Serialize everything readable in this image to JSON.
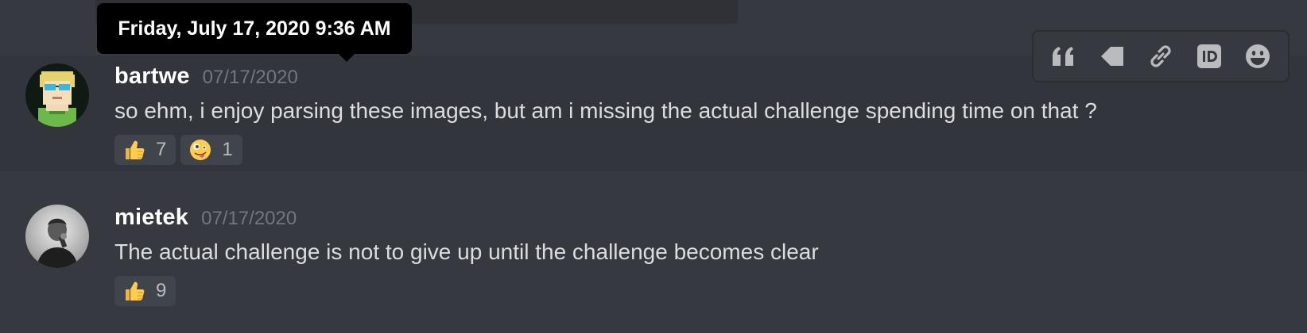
{
  "tooltip": {
    "text": "Friday, July 17, 2020 9:36 AM"
  },
  "messages": [
    {
      "username": "bartwe",
      "timestamp": "07/17/2020",
      "content": "so ehm, i enjoy parsing these images, but am i missing the actual challenge spending time on that ?",
      "avatar": "pixel-art-avatar",
      "reactions": [
        {
          "emoji": "thumbs-up-icon",
          "count": "7"
        },
        {
          "emoji": "zany-face-icon",
          "count": "1"
        }
      ]
    },
    {
      "username": "mietek",
      "timestamp": "07/17/2020",
      "content": "The actual challenge is not to give up until the challenge becomes clear",
      "avatar": "photo-avatar",
      "reactions": [
        {
          "emoji": "thumbs-up-icon",
          "count": "9"
        }
      ]
    }
  ],
  "toolbar": {
    "buttons": [
      "quote-icon",
      "tag-icon",
      "link-icon",
      "id-icon",
      "emoji-icon"
    ]
  },
  "colors": {
    "background": "#36393f",
    "hover_background": "#32353b",
    "username": "#ffffff",
    "timestamp": "#72767d",
    "text": "#dcddde",
    "reaction_bg": "#40444b",
    "icon": "#b9bbbe"
  }
}
